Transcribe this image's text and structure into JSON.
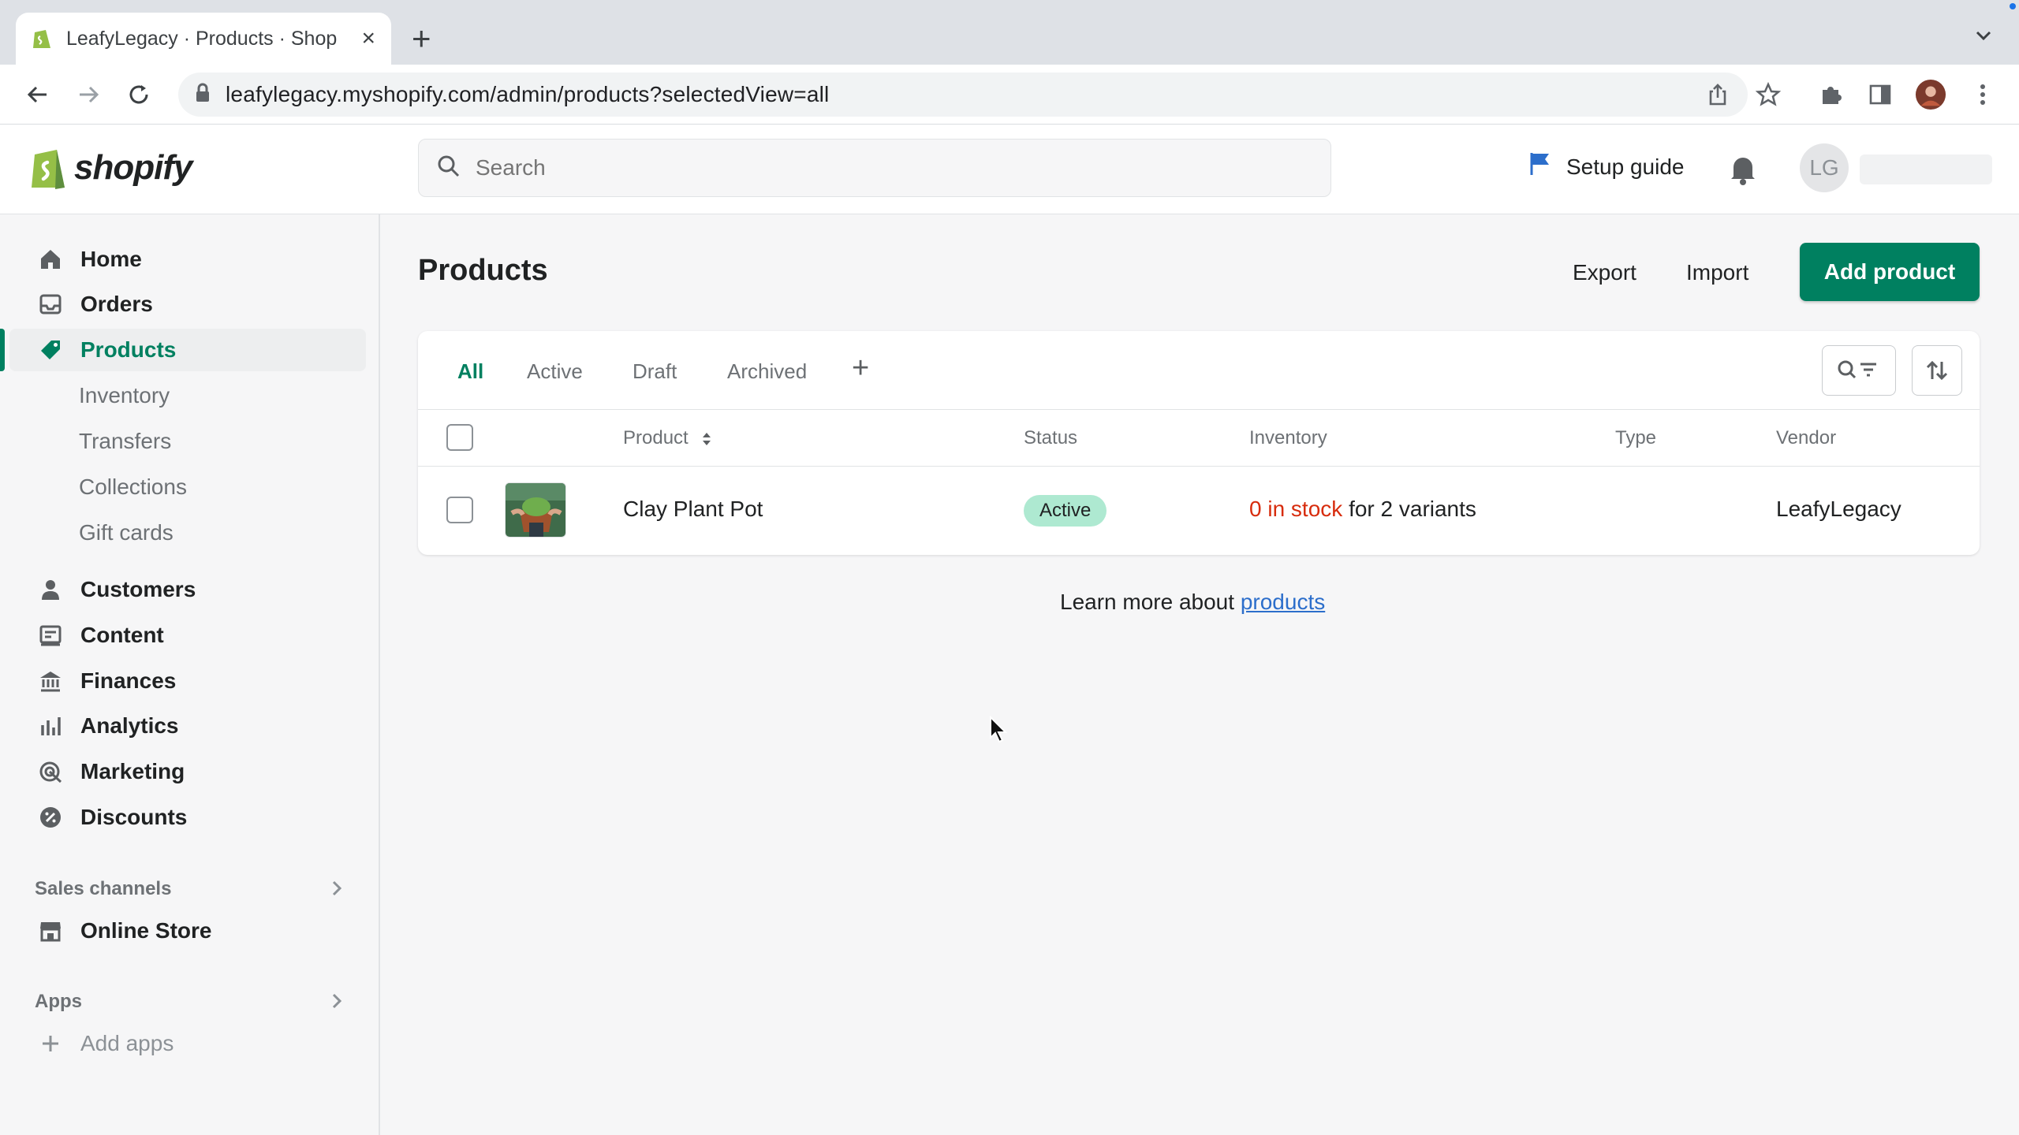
{
  "browser": {
    "tab_title": "LeafyLegacy · Products · Shop",
    "url": "leafylegacy.myshopify.com/admin/products?selectedView=all"
  },
  "topbar": {
    "logo_text": "shopify",
    "search_placeholder": "Search",
    "setup_guide": "Setup guide",
    "avatar_initials": "LG"
  },
  "sidebar": {
    "items": [
      {
        "label": "Home"
      },
      {
        "label": "Orders"
      },
      {
        "label": "Products"
      },
      {
        "label": "Customers"
      },
      {
        "label": "Content"
      },
      {
        "label": "Finances"
      },
      {
        "label": "Analytics"
      },
      {
        "label": "Marketing"
      },
      {
        "label": "Discounts"
      }
    ],
    "product_subitems": [
      "Inventory",
      "Transfers",
      "Collections",
      "Gift cards"
    ],
    "sales_channels_label": "Sales channels",
    "online_store": "Online Store",
    "apps_label": "Apps",
    "add_apps": "Add apps"
  },
  "main": {
    "title": "Products",
    "export": "Export",
    "import": "Import",
    "add_product": "Add product",
    "tabs": [
      "All",
      "Active",
      "Draft",
      "Archived"
    ],
    "columns": {
      "product": "Product",
      "status": "Status",
      "inventory": "Inventory",
      "type": "Type",
      "vendor": "Vendor"
    },
    "rows": [
      {
        "product": "Clay Plant Pot",
        "status": "Active",
        "inventory_stock": "0 in stock",
        "inventory_variants": "for 2 variants",
        "type": "",
        "vendor": "LeafyLegacy"
      }
    ],
    "learn_more_prefix": "Learn more about",
    "learn_more_link": "products"
  },
  "colors": {
    "brand_green": "#008060",
    "badge_green": "#aee9d1",
    "stock_red": "#d72c0d",
    "link_blue": "#2c6ecb"
  }
}
